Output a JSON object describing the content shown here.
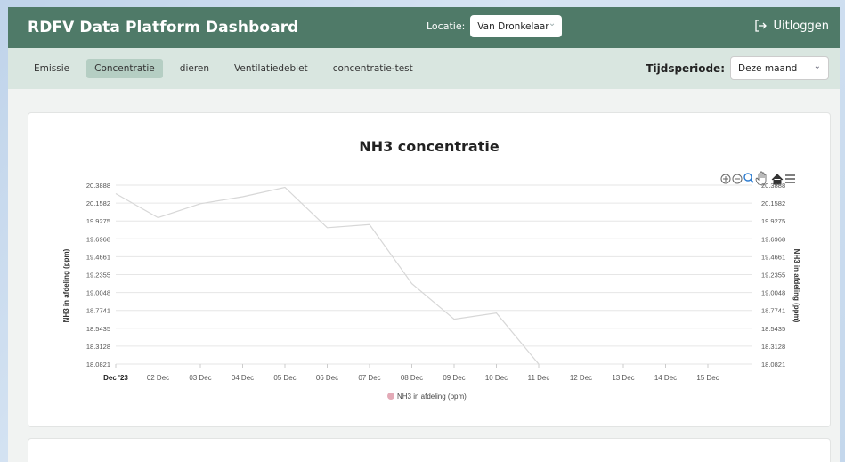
{
  "header": {
    "title": "RDFV Data Platform Dashboard",
    "location_label": "Locatie:",
    "location_value": "Van Dronkelaar",
    "logout_label": "Uitloggen"
  },
  "tabs": [
    {
      "label": "Emissie",
      "active": false
    },
    {
      "label": "Concentratie",
      "active": true
    },
    {
      "label": "dieren",
      "active": false
    },
    {
      "label": "Ventilatiedebiet",
      "active": false
    },
    {
      "label": "concentratie-test",
      "active": false
    }
  ],
  "period": {
    "label": "Tijdsperiode:",
    "value": "Deze maand"
  },
  "colors": {
    "header": "#4f7a68",
    "subnav": "#d9e6e0",
    "active_tab": "#b5cec3",
    "line": "#d7d7d7",
    "legend_marker": "#e3aab7"
  },
  "toolbar_icons": [
    "zoom-in-icon",
    "zoom-out-icon",
    "zoom-select-icon",
    "pan-hand-icon",
    "home-icon",
    "menu-icon"
  ],
  "chart_data": {
    "type": "line",
    "title": "NH3 concentratie",
    "ylabel": "NH3 in afdeling (ppm)",
    "ylabel_right": "NH3 in afdeling (ppm)",
    "y_ticks": [
      "20.3888",
      "20.1582",
      "19.9275",
      "19.6968",
      "19.4661",
      "19.2355",
      "19.0048",
      "18.7741",
      "18.5435",
      "18.3128",
      "18.0821"
    ],
    "ylim": [
      18.0821,
      20.3888
    ],
    "x_ticks": [
      "Dec '23",
      "02 Dec",
      "03 Dec",
      "04 Dec",
      "05 Dec",
      "06 Dec",
      "07 Dec",
      "08 Dec",
      "09 Dec",
      "10 Dec",
      "11 Dec",
      "12 Dec",
      "13 Dec",
      "14 Dec",
      "15 Dec"
    ],
    "series": [
      {
        "name": "NH3 in afdeling (ppm)",
        "x": [
          "Dec '23",
          "02 Dec",
          "03 Dec",
          "04 Dec",
          "05 Dec",
          "06 Dec",
          "07 Dec",
          "08 Dec",
          "09 Dec",
          "10 Dec",
          "11 Dec"
        ],
        "values": [
          20.28,
          19.97,
          20.15,
          20.24,
          20.36,
          19.84,
          19.88,
          19.12,
          18.66,
          18.74,
          18.08
        ]
      }
    ],
    "legend": "bottom-center",
    "grid": true
  }
}
